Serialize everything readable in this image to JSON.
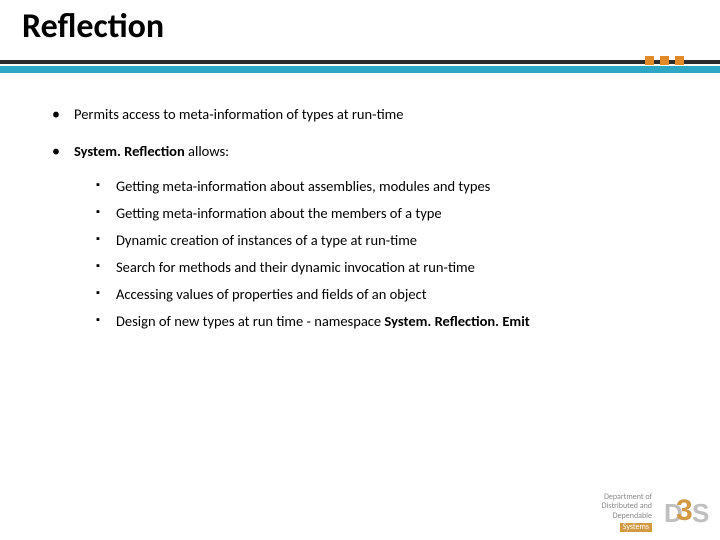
{
  "title": "Reflection",
  "bullets": [
    {
      "plain": "Permits access to meta-information of types at run-time"
    },
    {
      "prefix": "",
      "bold1": "System. Reflection",
      "suffix1": " allows:",
      "sub": [
        "Getting meta-information about assemblies, modules and types",
        "Getting meta-information about the members of a type",
        "Dynamic creation of instances of a type at run-time",
        "Search for methods and their dynamic invocation at run-time",
        "Accessing values of properties and fields of an object"
      ],
      "sub_last_pre": "Design of new types at run time - namespace ",
      "sub_last_bold": "System. Reflection. Emit"
    }
  ],
  "footer": {
    "line1": "Department of",
    "line2": "Distributed and",
    "line3": "Dependable",
    "line4": "Systems",
    "logo_d": "D",
    "logo_3": "3",
    "logo_s": "S"
  }
}
